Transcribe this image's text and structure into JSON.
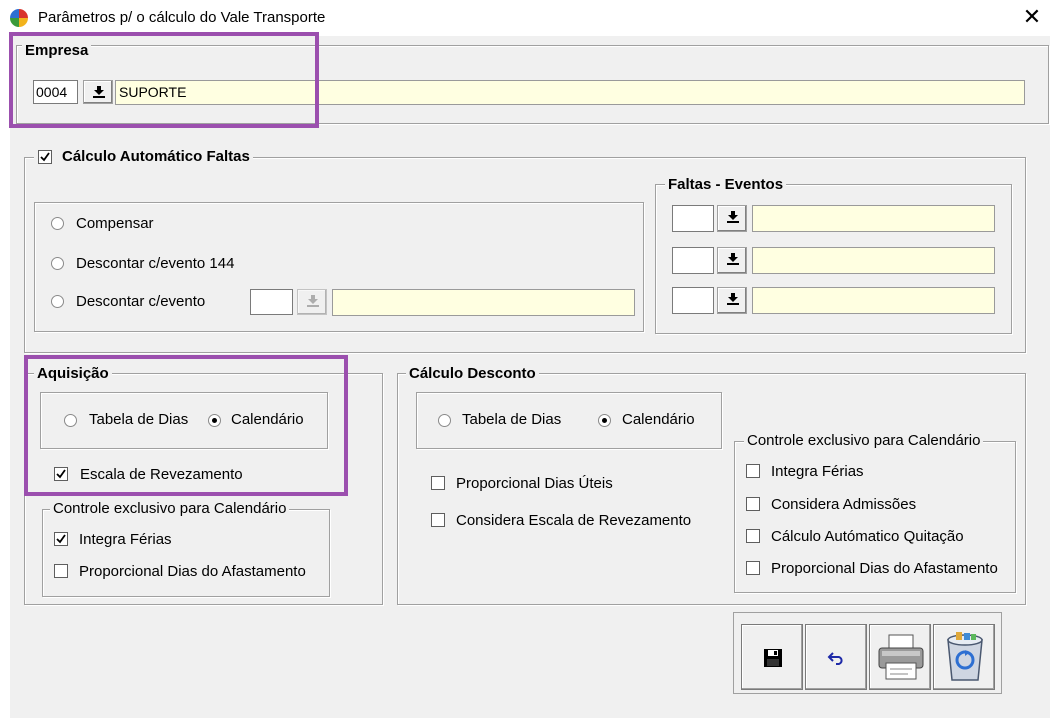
{
  "window": {
    "title": "Parâmetros p/ o cálculo do Vale Transporte",
    "close_label": "✕"
  },
  "empresa": {
    "legend": "Empresa",
    "code": "0004",
    "name": "SUPORTE"
  },
  "calc_faltas": {
    "legend": "Cálculo Automático Faltas",
    "checked": true,
    "options": [
      {
        "label": "Compensar",
        "selected": false
      },
      {
        "label": "Descontar c/evento 144",
        "selected": false
      },
      {
        "label": "Descontar c/evento",
        "selected": false
      }
    ],
    "evento_code": "",
    "evento_desc": ""
  },
  "faltas_eventos": {
    "legend": "Faltas - Eventos",
    "rows": [
      {
        "code": "",
        "desc": ""
      },
      {
        "code": "",
        "desc": ""
      },
      {
        "code": "",
        "desc": ""
      }
    ]
  },
  "aquisicao": {
    "legend": "Aquisição",
    "opt_tabela": "Tabela de Dias",
    "opt_calendario": "Calendário",
    "selected": "Calendário",
    "escala": "Escala de Revezamento",
    "escala_checked": true,
    "controle": {
      "legend": "Controle exclusivo para Calendário",
      "integra_ferias": "Integra Férias",
      "integra_checked": true,
      "proporcional": "Proporcional Dias do Afastamento",
      "proporcional_checked": false
    }
  },
  "calc_desconto": {
    "legend": "Cálculo Desconto",
    "opt_tabela": "Tabela de Dias",
    "opt_calendario": "Calendário",
    "selected": "Calendário",
    "proporcional_uteis": "Proporcional Dias Úteis",
    "considera_escala": "Considera Escala de Revezamento",
    "controle": {
      "legend": "Controle exclusivo para Calendário",
      "items": [
        "Integra Férias",
        "Considera Admissões",
        "Cálculo Autómatico Quitação",
        "Proporcional Dias do Afastamento"
      ]
    }
  },
  "toolbar": {
    "icons": [
      "save-icon",
      "undo-icon",
      "printer-icon",
      "recycle-bin-icon"
    ]
  },
  "colors": {
    "highlight": "#9b4fae",
    "yellow_field": "#ffffe1",
    "dialog_bg": "#f0f0f0"
  }
}
